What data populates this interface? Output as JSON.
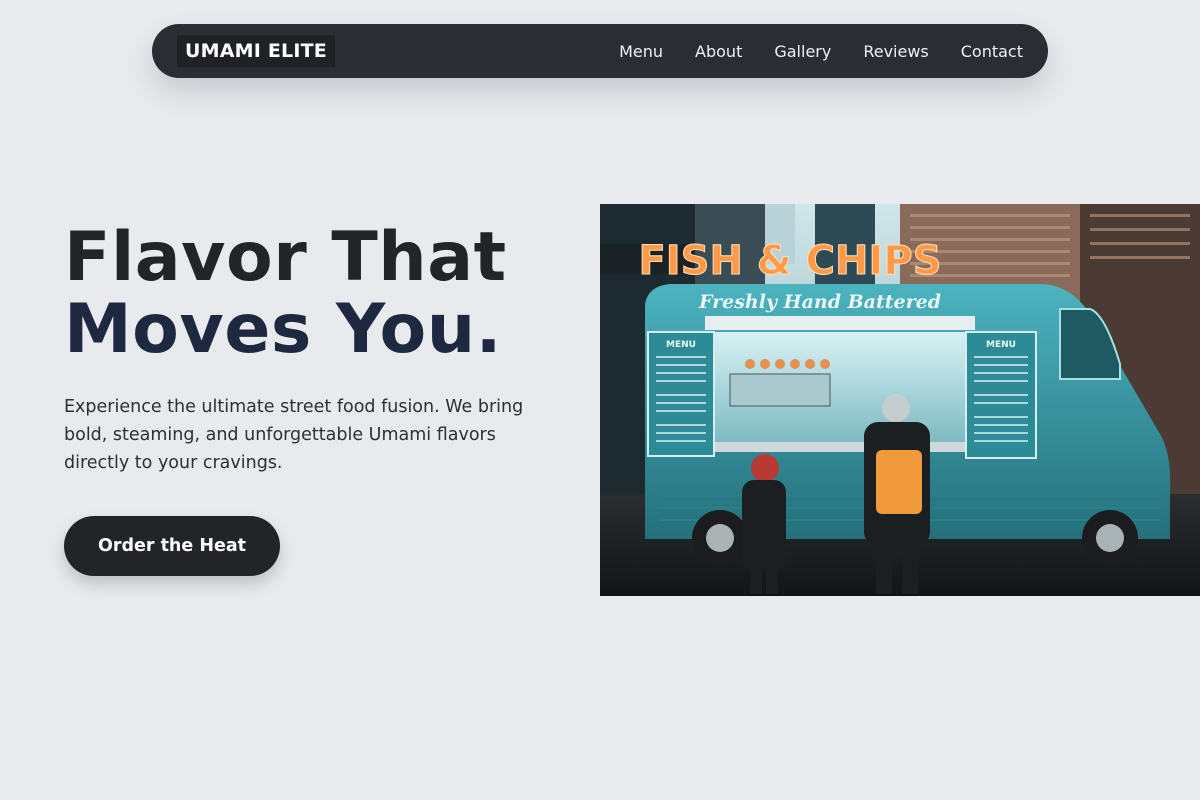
{
  "nav": {
    "brand": "UMAMI ELITE",
    "links": [
      "Menu",
      "About",
      "Gallery",
      "Reviews",
      "Contact"
    ]
  },
  "hero": {
    "title_line1": "Flavor That",
    "title_line2": "Moves You.",
    "description": "Experience the ultimate street food fusion. We bring bold, steaming, and unforgettable Umami flavors directly to your cravings.",
    "cta_label": "Order the Heat"
  },
  "image": {
    "sign": "FISH & CHIPS",
    "awning": "Freshly Hand Battered",
    "menu_left": "MENU",
    "menu_right": "MENU"
  },
  "colors": {
    "page_bg": "#e8eaee",
    "nav_bg": "#2a2d33",
    "title_dark": "#222428",
    "title_navy": "#1e2840",
    "button_bg": "#222428",
    "truck_teal": "#3ea3b0",
    "sign_orange": "#ff9a4a"
  }
}
